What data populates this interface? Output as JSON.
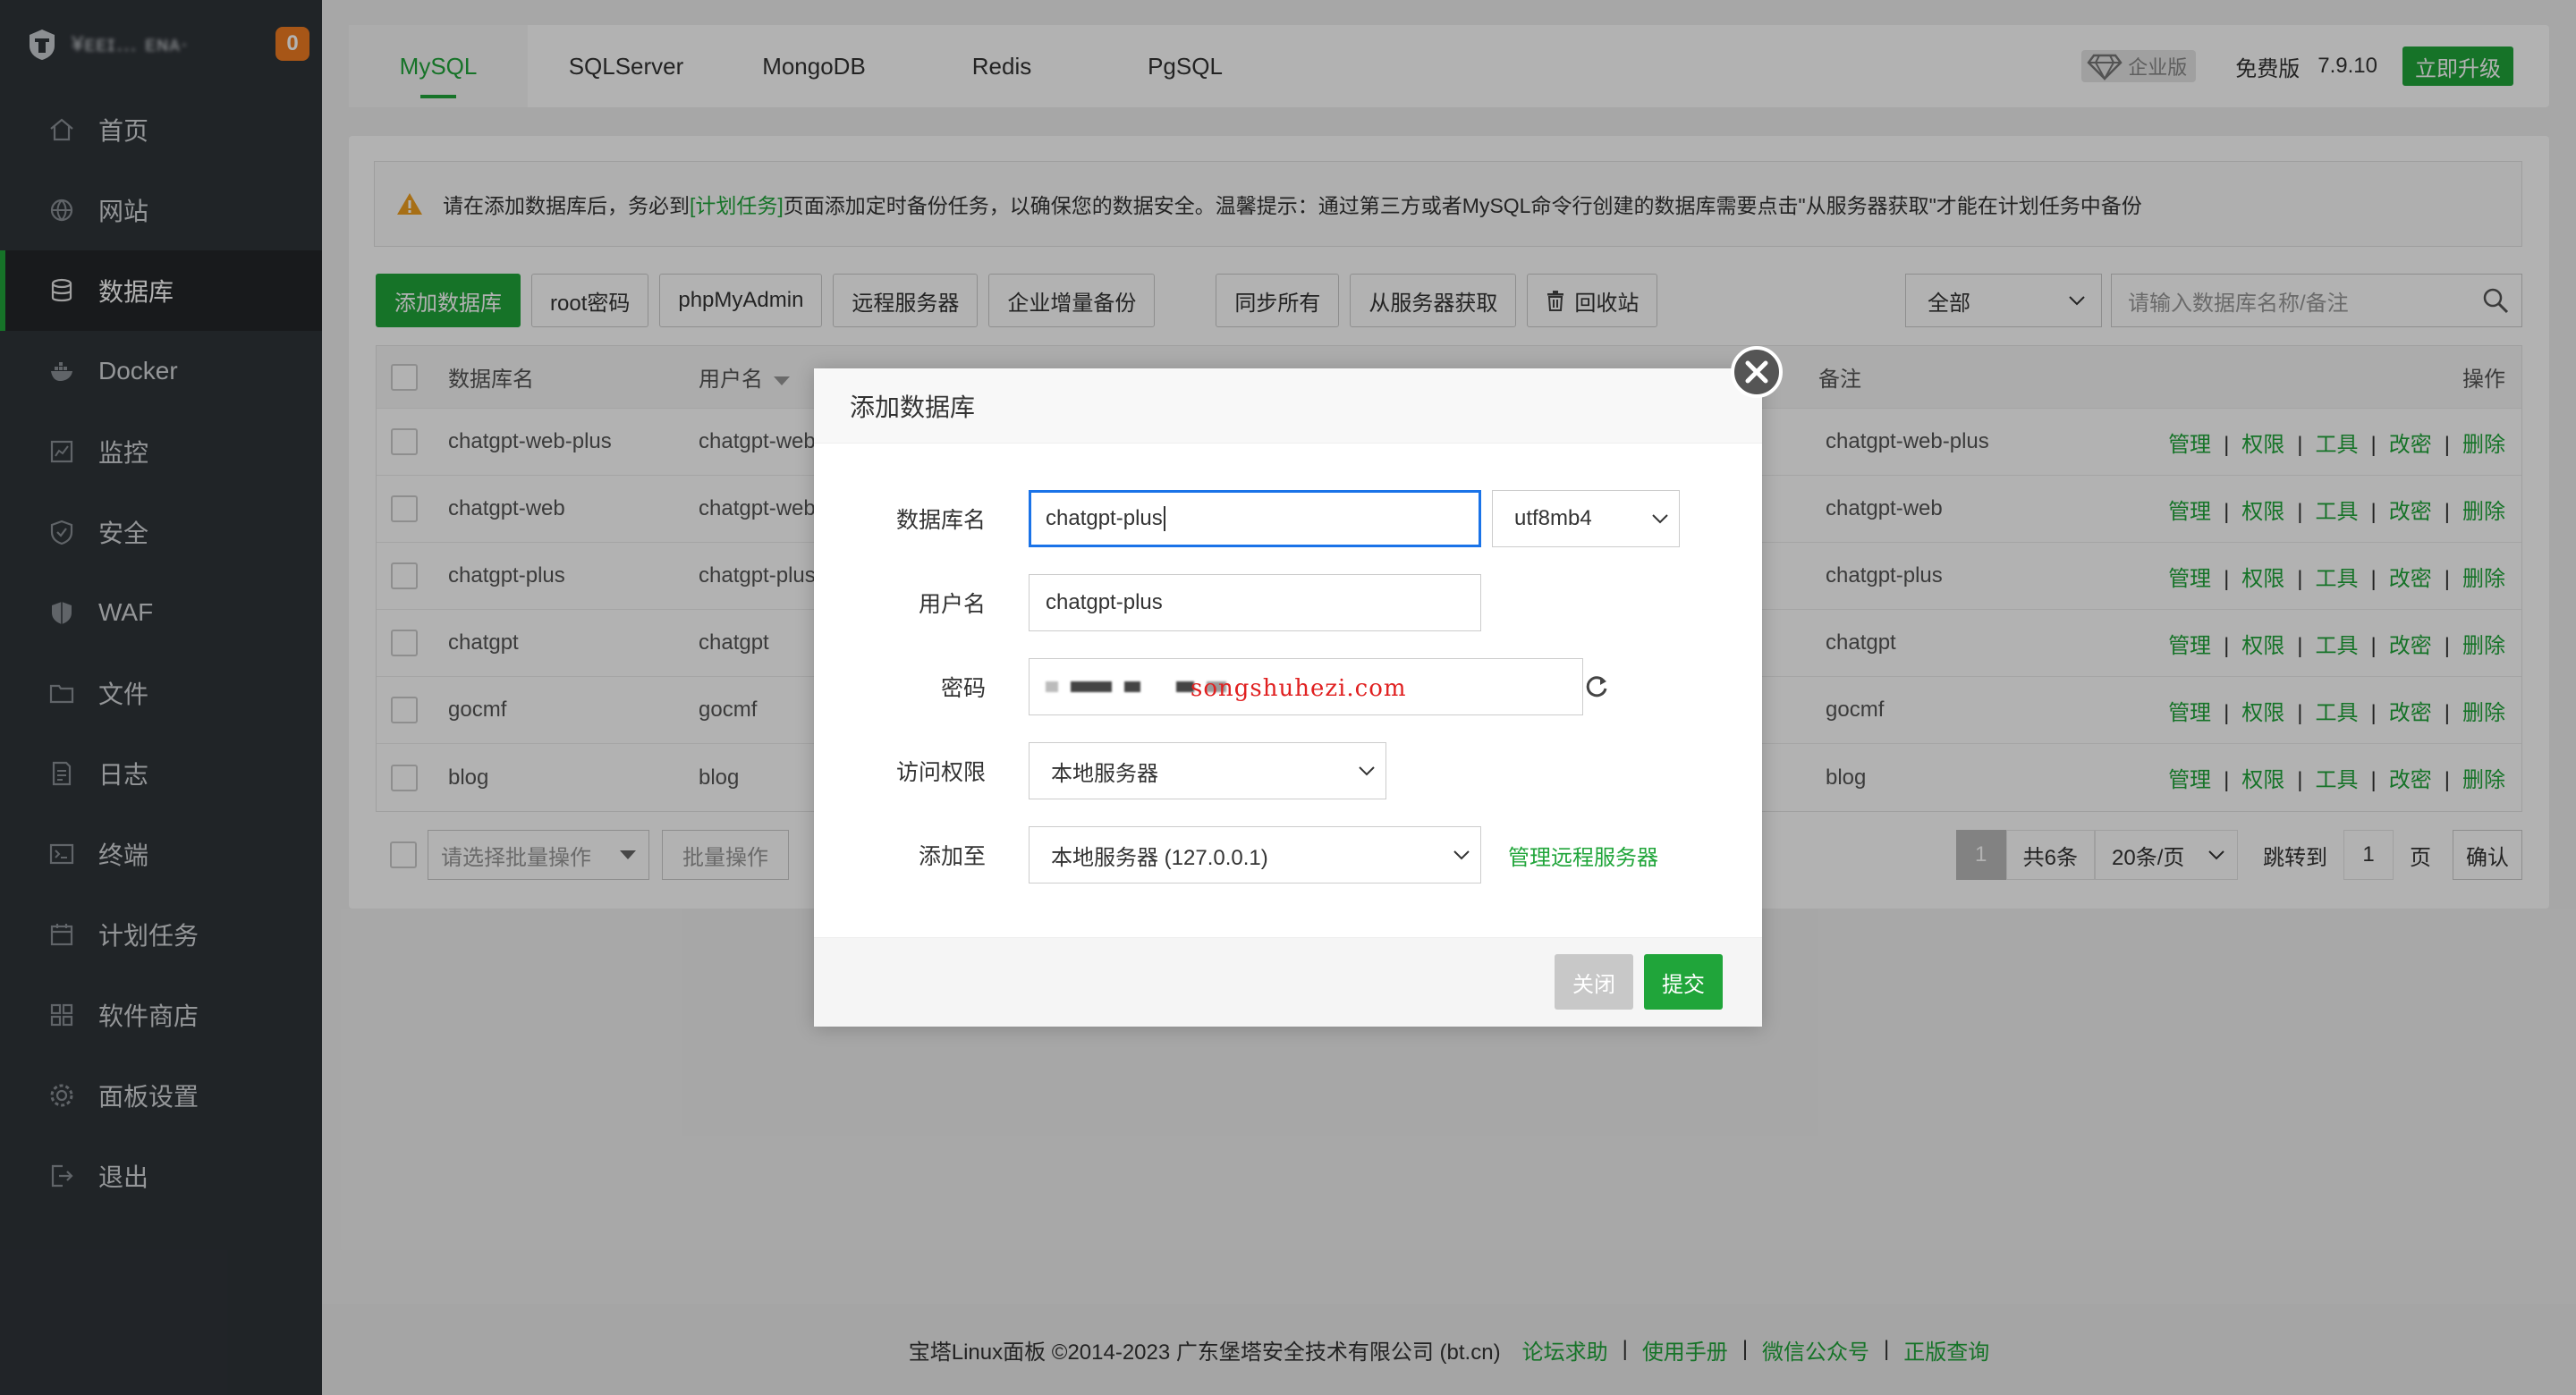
{
  "sidebar": {
    "server_name": "¥ᴇᴇɪ… ᴇɴᴀ·",
    "badge": "0",
    "items": [
      {
        "label": "首页",
        "icon": "home-icon"
      },
      {
        "label": "网站",
        "icon": "globe-icon"
      },
      {
        "label": "数据库",
        "icon": "database-icon",
        "active": true
      },
      {
        "label": "Docker",
        "icon": "docker-icon"
      },
      {
        "label": "监控",
        "icon": "monitor-icon"
      },
      {
        "label": "安全",
        "icon": "shield-icon"
      },
      {
        "label": "WAF",
        "icon": "waf-shield-icon"
      },
      {
        "label": "文件",
        "icon": "folder-icon"
      },
      {
        "label": "日志",
        "icon": "log-icon"
      },
      {
        "label": "终端",
        "icon": "terminal-icon"
      },
      {
        "label": "计划任务",
        "icon": "calendar-icon"
      },
      {
        "label": "软件商店",
        "icon": "apps-icon"
      },
      {
        "label": "面板设置",
        "icon": "gear-icon"
      },
      {
        "label": "退出",
        "icon": "logout-icon"
      }
    ]
  },
  "tabs": [
    "MySQL",
    "SQLServer",
    "MongoDB",
    "Redis",
    "PgSQL"
  ],
  "header": {
    "enterprise_label": "企业版",
    "edition": "免费版",
    "version": "7.9.10",
    "upgrade_label": "立即升级"
  },
  "warning": {
    "pre": "请在添加数据库后，务必到",
    "link": "[计划任务]",
    "post": "页面添加定时备份任务，以确保您的数据安全。温馨提示：通过第三方或者MySQL命令行创建的数据库需要点击\"从服务器获取\"才能在计划任务中备份"
  },
  "toolbar": {
    "add_db": "添加数据库",
    "root_pwd": "root密码",
    "phpmyadmin": "phpMyAdmin",
    "remote_server": "远程服务器",
    "enterprise_backup": "企业增量备份",
    "sync_all": "同步所有",
    "fetch_from_server": "从服务器获取",
    "recycle_bin": "回收站",
    "filter_value": "全部",
    "search_placeholder": "请输入数据库名称/备注"
  },
  "table": {
    "headers": {
      "name": "数据库名",
      "user": "用户名",
      "note": "备注",
      "ops": "操作"
    },
    "rows": [
      {
        "name": "chatgpt-web-plus",
        "user": "chatgpt-web",
        "note": "chatgpt-web-plus"
      },
      {
        "name": "chatgpt-web",
        "user": "chatgpt-web",
        "note": "chatgpt-web"
      },
      {
        "name": "chatgpt-plus",
        "user": "chatgpt-plus",
        "note": "chatgpt-plus"
      },
      {
        "name": "chatgpt",
        "user": "chatgpt",
        "note": "chatgpt"
      },
      {
        "name": "gocmf",
        "user": "gocmf",
        "note": "gocmf"
      },
      {
        "name": "blog",
        "user": "blog",
        "note": "blog"
      }
    ],
    "ops": [
      "管理",
      "权限",
      "工具",
      "改密",
      "删除"
    ]
  },
  "bottom": {
    "batch_placeholder": "请选择批量操作",
    "batch_button": "批量操作",
    "page_current": "1",
    "total": "共6条",
    "page_size": "20条/页",
    "jump_label": "跳转到",
    "jump_value": "1",
    "page_unit": "页",
    "confirm": "确认"
  },
  "footer": {
    "copyright": "宝塔Linux面板 ©2014-2023 广东堡塔安全技术有限公司 (bt.cn)",
    "links": [
      "论坛求助",
      "使用手册",
      "微信公众号",
      "正版查询"
    ]
  },
  "modal": {
    "title": "添加数据库",
    "db_name_label": "数据库名",
    "db_name_value": "chatgpt-plus",
    "charset": "utf8mb4",
    "username_label": "用户名",
    "username_value": "chatgpt-plus",
    "password_label": "密码",
    "watermark": "songshuhezi.com",
    "access_label": "访问权限",
    "access_value": "本地服务器",
    "add_to_label": "添加至",
    "add_to_value": "本地服务器 (127.0.0.1)",
    "manage_remote": "管理远程服务器",
    "close_label": "关闭",
    "submit_label": "提交"
  }
}
